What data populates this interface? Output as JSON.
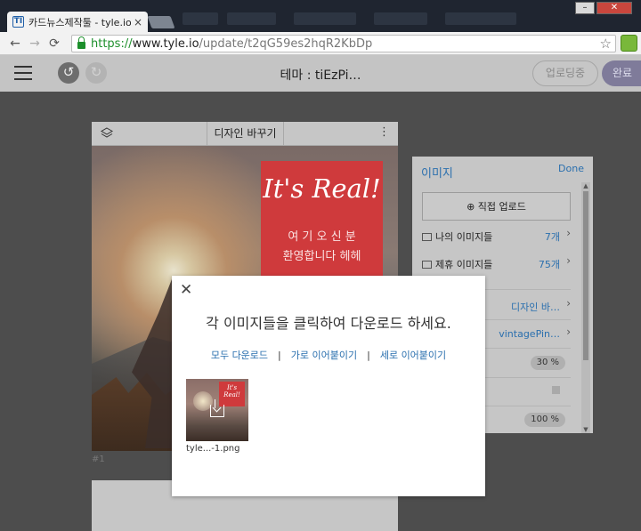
{
  "browser": {
    "tab_title": "카드뉴스제작툴 - tyle.io",
    "tab_favicon": "TI",
    "tab_close": "×",
    "url_proto": "https://",
    "url_host": "www.tyle.io",
    "url_path": "/update/t2qG59es2hqR2KbDp",
    "back_icon": "←",
    "forward_icon": "→",
    "reload_icon": "⟳",
    "star_icon": "☆",
    "win_min": "–",
    "win_max": "□",
    "win_close": "✕"
  },
  "app_header": {
    "theme_title": "테마 : tiEzPi…",
    "upload_label": "업로딩중",
    "done_label": "완료",
    "undo_icon": "↺",
    "redo_icon": "↻"
  },
  "card": {
    "design_button": "디자인 바꾸기",
    "menu_icon": "⋮",
    "headline": "It's Real!",
    "line1": "여 기 오 신 분",
    "line2": "환영합니다 헤헤",
    "card_number": "#1"
  },
  "panel": {
    "title": "이미지",
    "done": "Done",
    "upload": "⊕ 직접 업로드",
    "my_images_label": "나의 이미지들",
    "my_images_count": "7개",
    "partner_images_label": "제휴 이미지들",
    "partner_images_count": "75개",
    "design_value": "디자인 바…",
    "filter_value": "vintagePin…",
    "opacity_value": "30 %",
    "size_value": "100 %",
    "chevron": "›"
  },
  "modal": {
    "close_icon": "✕",
    "heading": "각 이미지들을 클릭하여 다운로드 하세요.",
    "link_all": "모두 다운로드",
    "link_horizontal": "가로 이어붙이기",
    "link_vertical": "세로 이어붙이기",
    "separator": "|",
    "thumb_headline": "It's Real!",
    "file_name": "tyle...-1.png"
  },
  "colors": {
    "accent_blue": "#2a6fae",
    "card_red": "#cf3a3c",
    "done_purple": "#7f7b9a",
    "ssl_green": "#1c8f2b"
  }
}
